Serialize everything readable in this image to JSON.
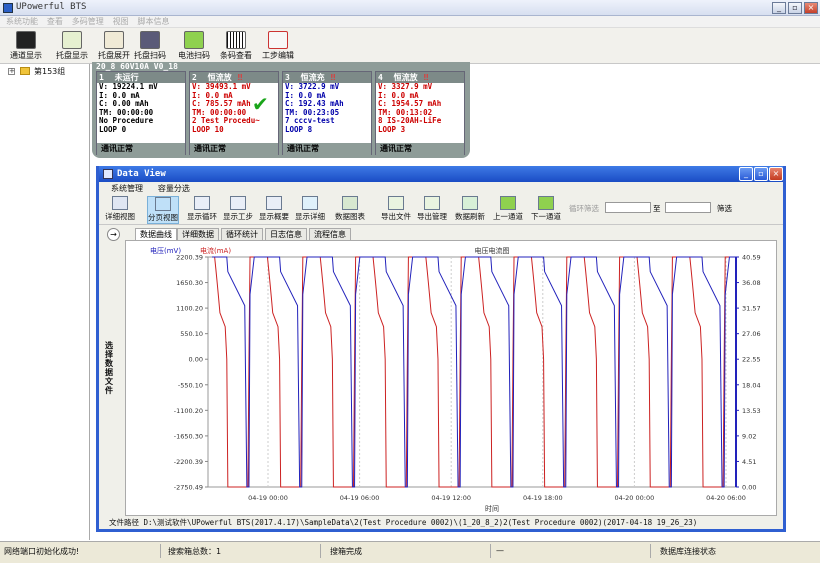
{
  "app": {
    "title": "UPowerful BTS"
  },
  "menubar": [
    "系统功能",
    "查看",
    "多码管理",
    "视图",
    "脚本信息"
  ],
  "toolbar": [
    "通道显示",
    "托盘显示",
    "托盘展开",
    "托盘扫码",
    "电池扫码",
    "条码查看",
    "工步编辑"
  ],
  "tree": {
    "root_label": "第153组"
  },
  "channel_panel": {
    "header": "20_8  60V10A V0_18",
    "channels": [
      {
        "num": "1",
        "state": "未运行",
        "warn": "",
        "lines": [
          "V: 19224.1 mV",
          "I: 0.0 mA",
          "C: 0.00 mAh",
          "TM: 00:00:00",
          "No Procedure",
          "LOOP 0"
        ],
        "status": "通讯正常",
        "color": "blk"
      },
      {
        "num": "2",
        "state": "恒流放",
        "warn": "‼",
        "lines": [
          "V: 39493.1 mV",
          "I: 0.0 mA",
          "C: 785.57 mAh",
          "TM: 00:00:00",
          "2 Test Procedu~",
          "LOOP 10"
        ],
        "status": "通讯正常",
        "color": "red"
      },
      {
        "num": "3",
        "state": "恒流充",
        "warn": "‼",
        "lines": [
          "V: 3722.9 mV",
          "I: 0.0 mA",
          "C: 192.43 mAh",
          "TM: 00:23:05",
          "7 cccv-test",
          "LOOP 8"
        ],
        "status": "通讯正常",
        "color": "blu"
      },
      {
        "num": "4",
        "state": "恒流放",
        "warn": "‼",
        "lines": [
          "V: 3327.9 mV",
          "I: 0.0 mA",
          "C: 1954.57 mAh",
          "TM: 00:13:02",
          "8 IS-20AH-LiFe",
          "LOOP 3"
        ],
        "status": "通讯正常",
        "color": "red"
      }
    ]
  },
  "dataview": {
    "title": "Data View",
    "menu": [
      "系统管理",
      "容量分选"
    ],
    "tools": [
      "详细视图",
      "分页视图",
      "显示循环",
      "显示工步",
      "显示概要",
      "显示详细",
      "数据图表",
      "导出文件",
      "导出管理",
      "数据刷新",
      "上一通道",
      "下一通道"
    ],
    "filter": {
      "label": "循环筛选",
      "to": "至",
      "apply": "筛选"
    },
    "tabs": [
      "数据曲线",
      "详细数据",
      "循环统计",
      "日志信息",
      "流程信息"
    ],
    "side_label": "选择数据文件",
    "footer": "文件路径 D:\\测试软件\\UPowerful BTS(2017.4.17)\\SampleData\\2(Test Procedure 0002)\\(1_20_8_2)2(Test Procedure 0002)(2017-04-18 19_26_23)"
  },
  "chart_data": {
    "type": "line",
    "title": "电压电流图",
    "xlabel": "时间",
    "y_left_label": "电压(mV)",
    "y_left_label2": "电流(mA)",
    "y_left_ticks": [
      "2200.39",
      "1650.30",
      "1100.20",
      "550.10",
      "0.00",
      "-550.10",
      "-1100.20",
      "-1650.30",
      "-2200.39",
      "-2750.49"
    ],
    "y_right_ticks": [
      "40.59",
      "36.08",
      "31.57",
      "27.06",
      "22.55",
      "18.04",
      "13.53",
      "9.02",
      "4.51",
      "0.00"
    ],
    "x_ticks": [
      "04-19 00:00",
      "04-19 06:00",
      "04-19 12:00",
      "04-19 18:00",
      "04-20 00:00",
      "04-20 06:00"
    ],
    "ylim_left": [
      -2750.49,
      2200.39
    ],
    "ylim_right": [
      0,
      40.59
    ],
    "cycles": 10,
    "current_charge_mA": 2200,
    "current_discharge_mA": -2750,
    "voltage_max": 40.59,
    "voltage_min": 0.0,
    "colors": {
      "current": "#cc2222",
      "voltage": "#2222bb"
    }
  },
  "statusbar": [
    "网络端口初始化成功!",
    "搜索箱总数：1",
    "搜箱完成",
    "—",
    "数据库连接状态"
  ]
}
